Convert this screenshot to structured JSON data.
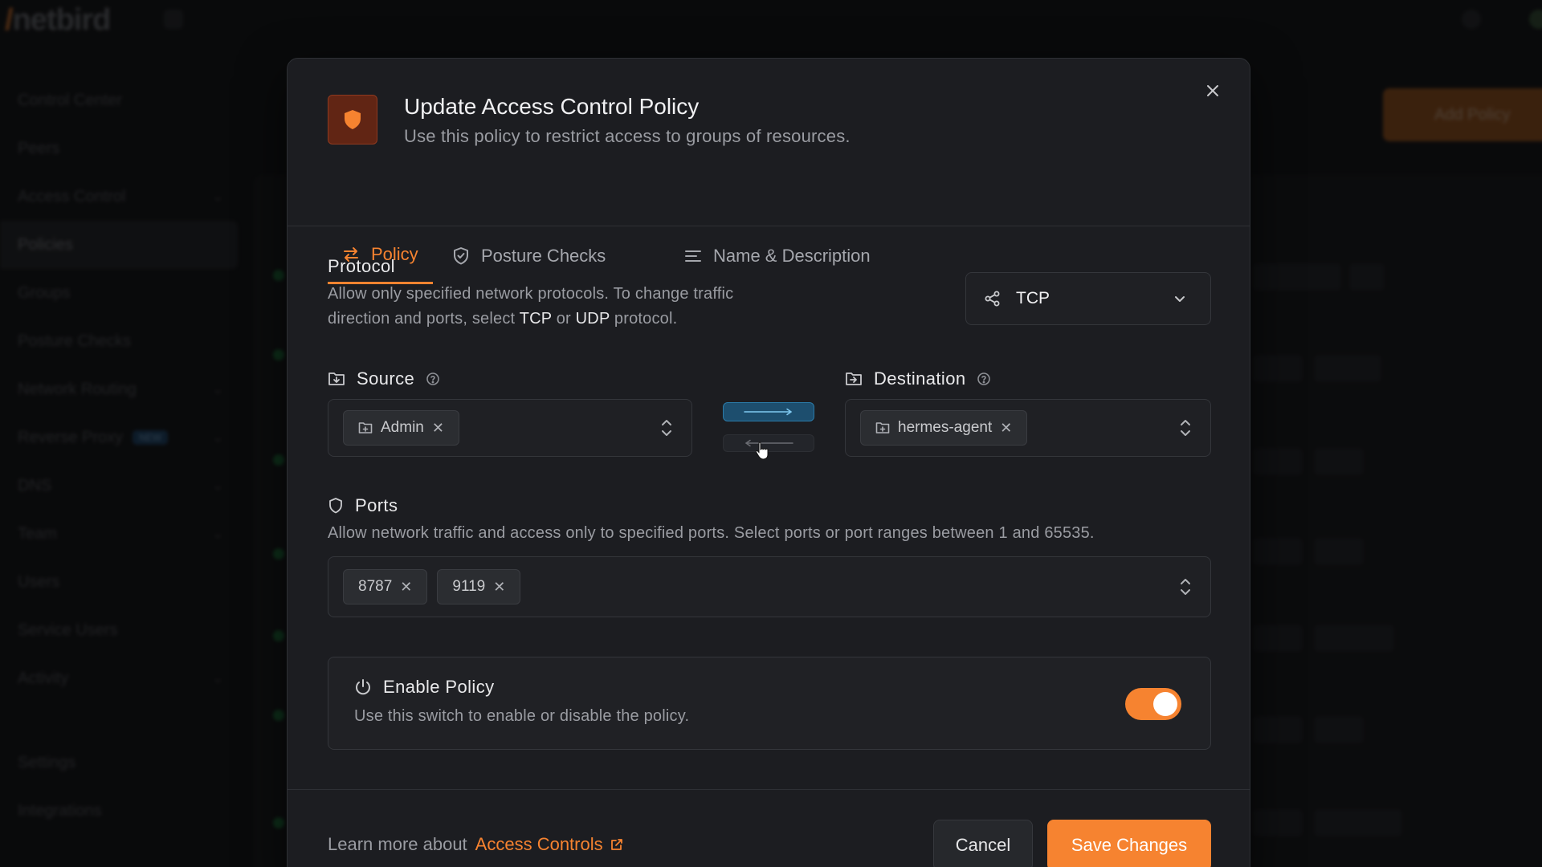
{
  "background": {
    "logo_text": "netbird",
    "add_button_label": "Add Policy",
    "nav": [
      {
        "label": "Control Center",
        "active": false,
        "caret": false
      },
      {
        "label": "Peers",
        "active": false,
        "caret": false
      },
      {
        "label": "Access Control",
        "active": false,
        "caret": true
      },
      {
        "label": "Policies",
        "active": true,
        "caret": false
      },
      {
        "label": "Groups",
        "active": false,
        "caret": false
      },
      {
        "label": "Posture Checks",
        "active": false,
        "caret": false
      },
      {
        "label": "Network Routing",
        "active": false,
        "caret": true
      },
      {
        "label": "Reverse Proxy",
        "active": false,
        "caret": true,
        "badge": "NEW"
      },
      {
        "label": "DNS",
        "active": false,
        "caret": true
      },
      {
        "label": "Team",
        "active": false,
        "caret": true
      },
      {
        "label": "Users",
        "active": false,
        "caret": false
      },
      {
        "label": "Service Users",
        "active": false,
        "caret": false
      },
      {
        "label": "Activity",
        "active": false,
        "caret": true
      },
      {
        "label": "Settings",
        "active": false,
        "caret": false
      },
      {
        "label": "Integrations",
        "active": false,
        "caret": false
      }
    ]
  },
  "modal": {
    "title": "Update Access Control Policy",
    "subtitle": "Use this policy to restrict access to groups of resources.",
    "tabs": [
      {
        "label": "Policy",
        "icon": "arrows-exchange-icon",
        "active": true
      },
      {
        "label": "Posture Checks",
        "icon": "shield-check-icon",
        "active": false
      },
      {
        "label": "Name & Description",
        "icon": "text-lines-icon",
        "active": false
      }
    ],
    "protocol": {
      "title": "Protocol",
      "desc_line1": "Allow only specified network protocols. To change traffic",
      "desc_line2_pre": "direction and ports, select ",
      "desc_tcp": "TCP",
      "desc_or": " or ",
      "desc_udp": "UDP",
      "desc_end": " protocol.",
      "selected": "TCP"
    },
    "source": {
      "title": "Source",
      "chips": [
        "Admin"
      ]
    },
    "destination": {
      "title": "Destination",
      "chips": [
        "hermes-agent"
      ]
    },
    "ports": {
      "title": "Ports",
      "desc": "Allow network traffic and access only to specified ports. Select ports or port ranges between 1 and 65535.",
      "chips": [
        "8787",
        "9119"
      ]
    },
    "enable": {
      "title": "Enable Policy",
      "desc": "Use this switch to enable or disable the policy.",
      "enabled": true
    },
    "footer": {
      "learn_more": "Learn more about",
      "link": "Access Controls",
      "cancel": "Cancel",
      "save": "Save Changes"
    }
  },
  "colors": {
    "accent": "#f68330",
    "direction_active": "#1d4e6e"
  }
}
